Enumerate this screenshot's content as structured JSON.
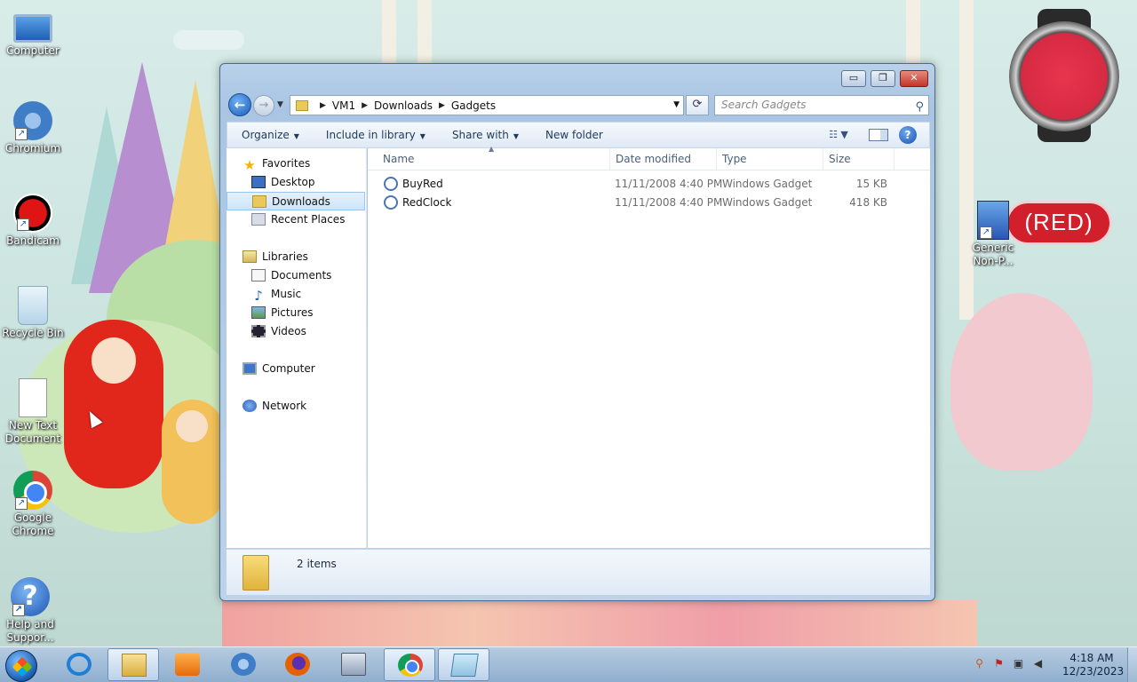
{
  "desktop": {
    "icons": [
      {
        "label": "Computer",
        "icon": "computer-icon"
      },
      {
        "label": "Chromium",
        "icon": "chromium-icon"
      },
      {
        "label": "Bandicam",
        "icon": "bandicam-icon"
      },
      {
        "label": "Recycle Bin",
        "icon": "recycle-bin-icon"
      },
      {
        "label": "New Text Document",
        "icon": "text-document-icon"
      },
      {
        "label": "Google Chrome",
        "icon": "chrome-icon"
      },
      {
        "label": "Help and Suppor...",
        "icon": "help-icon"
      },
      {
        "label": "Generic Non-P...",
        "icon": "generic-printer-icon"
      }
    ],
    "red_badge_text": "(RED)"
  },
  "explorer": {
    "window_buttons": {
      "minimize": "▭",
      "maximize": "❐",
      "close": "✕"
    },
    "address": {
      "breadcrumbs": [
        "VM1",
        "Downloads",
        "Gadgets"
      ]
    },
    "search": {
      "placeholder": "Search Gadgets"
    },
    "toolbar": {
      "organize": "Organize",
      "include_in_library": "Include in library",
      "share_with": "Share with",
      "new_folder": "New folder"
    },
    "nav_pane": {
      "favorites": "Favorites",
      "favorites_items": [
        "Desktop",
        "Downloads",
        "Recent Places"
      ],
      "selected": "Downloads",
      "libraries": "Libraries",
      "libraries_items": [
        "Documents",
        "Music",
        "Pictures",
        "Videos"
      ],
      "computer": "Computer",
      "network": "Network"
    },
    "columns": [
      "Name",
      "Date modified",
      "Type",
      "Size"
    ],
    "files": [
      {
        "name": "BuyRed",
        "date_modified": "11/11/2008 4:40 PM",
        "type": "Windows Gadget",
        "size": "15 KB"
      },
      {
        "name": "RedClock",
        "date_modified": "11/11/2008 4:40 PM",
        "type": "Windows Gadget",
        "size": "418 KB"
      }
    ],
    "status": {
      "item_count": "2 items"
    }
  },
  "taskbar": {
    "apps": [
      "internet-explorer",
      "windows-explorer",
      "media-player",
      "chromium",
      "firefox",
      "on-screen-keyboard",
      "google-chrome",
      "notepad"
    ],
    "active_apps": [
      "windows-explorer",
      "google-chrome",
      "notepad"
    ],
    "clock": {
      "time": "4:18 AM",
      "date": "12/23/2023"
    }
  }
}
